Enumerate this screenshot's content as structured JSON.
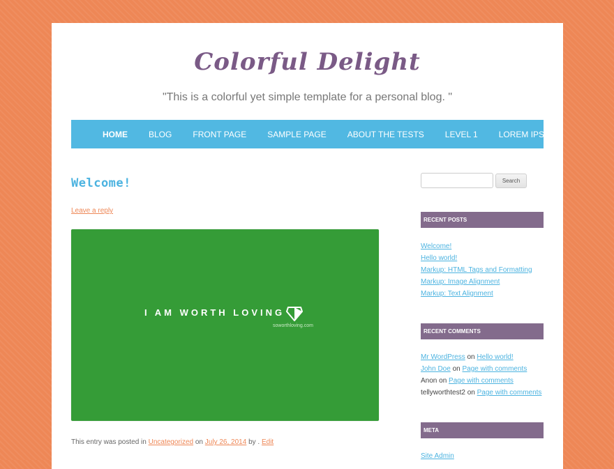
{
  "site": {
    "title": "Colorful Delight",
    "description": "\"This is a colorful yet simple template for a personal blog. \""
  },
  "nav": {
    "items": [
      {
        "label": "HOME"
      },
      {
        "label": "BLOG"
      },
      {
        "label": "FRONT PAGE"
      },
      {
        "label": "SAMPLE PAGE"
      },
      {
        "label": "ABOUT THE TESTS"
      },
      {
        "label": "LEVEL 1"
      },
      {
        "label": "LOREM IPSUM"
      }
    ]
  },
  "post": {
    "title": "Welcome!",
    "reply_link": "Leave a reply",
    "image": {
      "text": "I AM WORTH LOVING",
      "subtext": "soworthloving.com",
      "icon": "diamond-icon"
    },
    "meta": {
      "prefix": "This entry was posted in",
      "category": "Uncategorized",
      "on_word": "on",
      "date": "July 26, 2014",
      "by_word": "by .",
      "edit": "Edit"
    }
  },
  "sidebar": {
    "search": {
      "button": "Search",
      "placeholder": ""
    },
    "recent_posts": {
      "title": "RECENT POSTS",
      "items": [
        "Welcome!",
        "Hello world!",
        "Markup: HTML Tags and Formatting",
        "Markup: Image Alignment",
        "Markup: Text Alignment"
      ]
    },
    "recent_comments": {
      "title": "RECENT COMMENTS",
      "items": [
        {
          "author": "Mr WordPress",
          "on": "on",
          "post": "Hello world!"
        },
        {
          "author": "John Doe",
          "on": "on",
          "post": "Page with comments"
        },
        {
          "author": "Anon",
          "on": "on",
          "post": "Page with comments"
        },
        {
          "author": "tellyworthtest2",
          "on": "on",
          "post": "Page with comments"
        }
      ]
    },
    "meta": {
      "title": "META",
      "items": [
        "Site Admin"
      ]
    }
  },
  "colors": {
    "background": "#ee8756",
    "nav": "#51b8e2",
    "widget_header": "#836b8c",
    "title": "#7a5a86",
    "link": "#4cb3e0",
    "hero": "#359c37"
  }
}
